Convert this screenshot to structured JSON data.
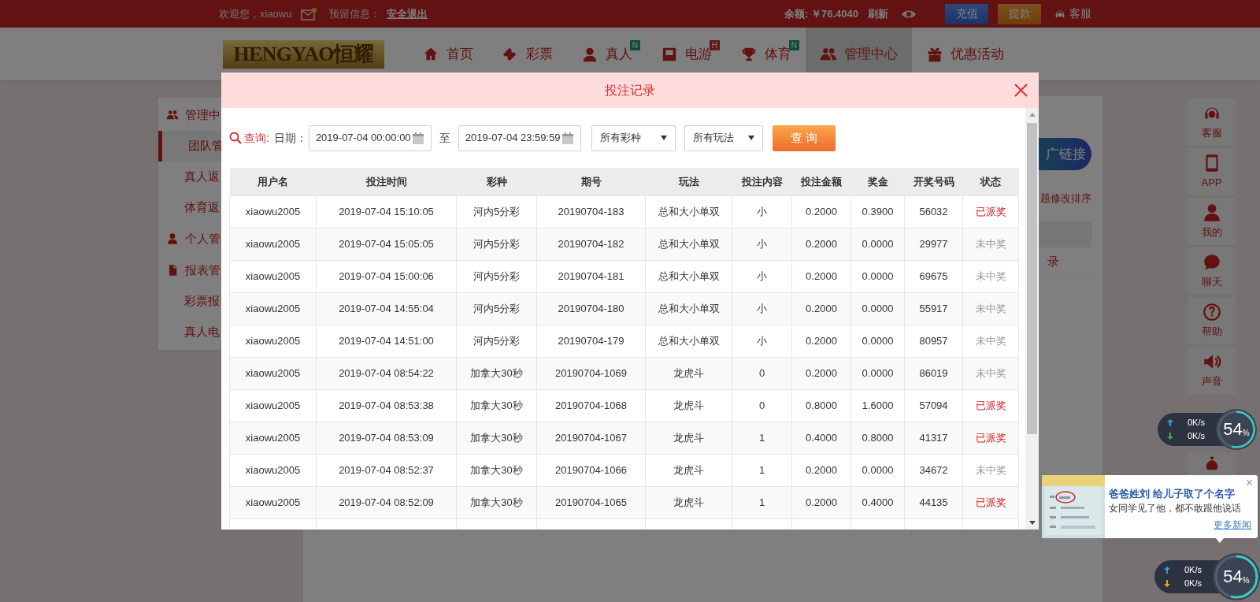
{
  "top_bar": {
    "welcome": "欢迎您，xiaowu",
    "reserved_info": "预留信息：",
    "logout": "安全退出",
    "balance": "余额: ￥76.4040",
    "refresh": "刷新",
    "buttons": [
      {
        "label": "充值",
        "kind": "deposit"
      },
      {
        "label": "提款",
        "kind": "withdraw"
      }
    ],
    "service": "客服"
  },
  "nav": {
    "logo": "HENGYAO恒耀",
    "items": [
      {
        "label": "首页",
        "selected": false
      },
      {
        "label": "彩票",
        "selected": false
      },
      {
        "label": "真人",
        "badge": {
          "text": "N",
          "kind": "new"
        },
        "selected": false
      },
      {
        "label": "电游",
        "badge": {
          "text": "H",
          "kind": "hot"
        },
        "selected": false
      },
      {
        "label": "体育",
        "badge": {
          "text": "N",
          "kind": "new"
        },
        "selected": false
      },
      {
        "label": "管理中心",
        "selected": true
      },
      {
        "label": "优惠活动",
        "selected": false
      }
    ]
  },
  "sidebar": {
    "items": [
      {
        "label": "管理中",
        "kind": "group"
      },
      {
        "label": "团队管",
        "kind": "item",
        "selected": true
      },
      {
        "label": "真人返",
        "kind": "item",
        "selected": false
      },
      {
        "label": "体育返",
        "kind": "item",
        "selected": false
      },
      {
        "label": "个人管",
        "kind": "group"
      },
      {
        "label": "报表管",
        "kind": "group"
      },
      {
        "label": "彩票报",
        "kind": "item",
        "selected": false
      },
      {
        "label": "真人电",
        "kind": "item",
        "selected": false
      }
    ]
  },
  "content": {
    "link_button": "广链接",
    "sort_hint": "题修改排序",
    "row_text": "录"
  },
  "right_dock": [
    {
      "label": "客服"
    },
    {
      "label": "APP"
    },
    {
      "label": "我的"
    },
    {
      "label": "聊天"
    },
    {
      "label": "帮助"
    },
    {
      "label": "声音"
    }
  ],
  "modal": {
    "title": "投注记录",
    "query_label": "查询:",
    "date_label": "日期：",
    "date_from": "2019-07-04 00:00:00",
    "date_sep": "至",
    "date_to": "2019-07-04 23:59:59",
    "selects": [
      "所有彩种",
      "所有玩法"
    ],
    "search_button": "查 询",
    "table": {
      "columns": [
        "用户名",
        "投注时间",
        "彩种",
        "期号",
        "玩法",
        "投注内容",
        "投注金额",
        "奖金",
        "开奖号码",
        "状态"
      ],
      "rows": [
        {
          "cells": [
            "xiaowu2005",
            "2019-07-04 15:10:05",
            "河内5分彩",
            "20190704-183",
            "总和大小单双",
            "小",
            "0.2000",
            "0.3900",
            "56032"
          ],
          "status": "已派奖",
          "won": true
        },
        {
          "cells": [
            "xiaowu2005",
            "2019-07-04 15:05:05",
            "河内5分彩",
            "20190704-182",
            "总和大小单双",
            "小",
            "0.2000",
            "0.0000",
            "29977"
          ],
          "status": "未中奖",
          "won": false
        },
        {
          "cells": [
            "xiaowu2005",
            "2019-07-04 15:00:06",
            "河内5分彩",
            "20190704-181",
            "总和大小单双",
            "小",
            "0.2000",
            "0.0000",
            "69675"
          ],
          "status": "未中奖",
          "won": false
        },
        {
          "cells": [
            "xiaowu2005",
            "2019-07-04 14:55:04",
            "河内5分彩",
            "20190704-180",
            "总和大小单双",
            "小",
            "0.2000",
            "0.0000",
            "55917"
          ],
          "status": "未中奖",
          "won": false
        },
        {
          "cells": [
            "xiaowu2005",
            "2019-07-04 14:51:00",
            "河内5分彩",
            "20190704-179",
            "总和大小单双",
            "小",
            "0.2000",
            "0.0000",
            "80957"
          ],
          "status": "未中奖",
          "won": false
        },
        {
          "cells": [
            "xiaowu2005",
            "2019-07-04 08:54:22",
            "加拿大30秒",
            "20190704-1069",
            "龙虎斗",
            "0",
            "0.2000",
            "0.0000",
            "86019"
          ],
          "status": "未中奖",
          "won": false
        },
        {
          "cells": [
            "xiaowu2005",
            "2019-07-04 08:53:38",
            "加拿大30秒",
            "20190704-1068",
            "龙虎斗",
            "0",
            "0.8000",
            "1.6000",
            "57094"
          ],
          "status": "已派奖",
          "won": true
        },
        {
          "cells": [
            "xiaowu2005",
            "2019-07-04 08:53:09",
            "加拿大30秒",
            "20190704-1067",
            "龙虎斗",
            "1",
            "0.4000",
            "0.8000",
            "41317"
          ],
          "status": "已派奖",
          "won": true
        },
        {
          "cells": [
            "xiaowu2005",
            "2019-07-04 08:52:37",
            "加拿大30秒",
            "20190704-1066",
            "龙虎斗",
            "1",
            "0.2000",
            "0.0000",
            "34672"
          ],
          "status": "未中奖",
          "won": false
        },
        {
          "cells": [
            "xiaowu2005",
            "2019-07-04 08:52:09",
            "加拿大30秒",
            "20190704-1065",
            "龙虎斗",
            "1",
            "0.2000",
            "0.4000",
            "44135"
          ],
          "status": "已派奖",
          "won": true
        }
      ]
    }
  },
  "net_meters": [
    {
      "up": "0K/s",
      "down": "0K/s",
      "percent": "54",
      "unit": "%",
      "level": 0.54
    },
    {
      "up": "0K/s",
      "down": "0K/s",
      "percent": "54",
      "unit": "%",
      "level": 0.54
    }
  ],
  "news": {
    "title": "爸爸姓刘 给儿子取了个名字",
    "text": "女同学见了他，都不敢跟他说话",
    "more": "更多新闻",
    "close": "×"
  }
}
